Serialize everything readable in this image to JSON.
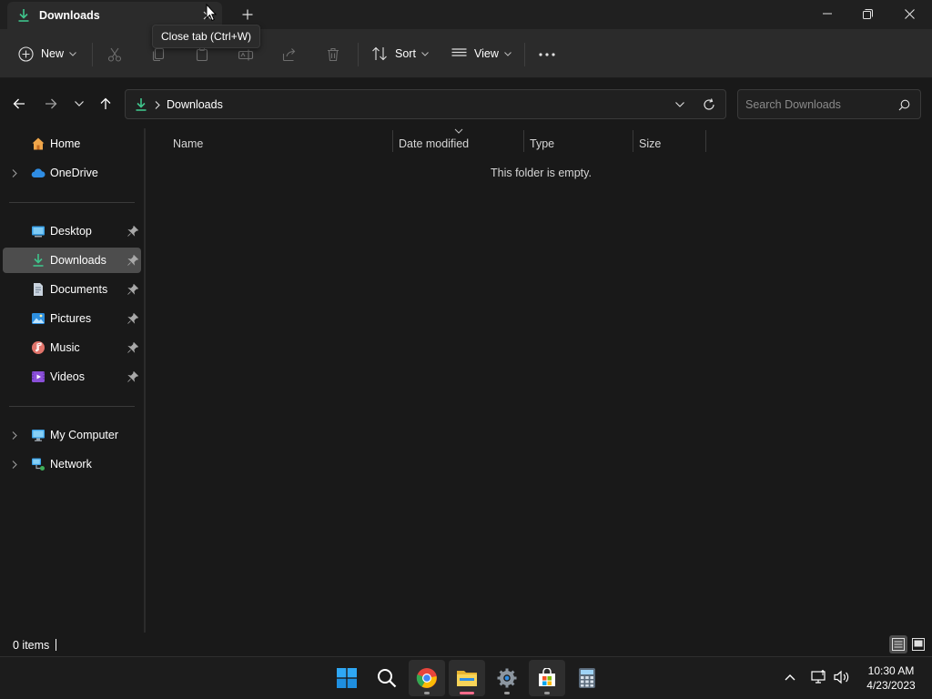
{
  "window": {
    "tab_title": "Downloads",
    "tooltip": "Close tab (Ctrl+W)"
  },
  "commandbar": {
    "new_label": "New",
    "sort_label": "Sort",
    "view_label": "View"
  },
  "address": {
    "path": "Downloads",
    "search_placeholder": "Search Downloads"
  },
  "sidebar": {
    "items": [
      {
        "label": "Home",
        "icon": "home-icon"
      },
      {
        "label": "OneDrive",
        "icon": "cloud-icon"
      },
      {
        "label": "Desktop",
        "icon": "desktop-icon"
      },
      {
        "label": "Downloads",
        "icon": "download-icon"
      },
      {
        "label": "Documents",
        "icon": "documents-icon"
      },
      {
        "label": "Pictures",
        "icon": "pictures-icon"
      },
      {
        "label": "Music",
        "icon": "music-icon"
      },
      {
        "label": "Videos",
        "icon": "videos-icon"
      },
      {
        "label": "My Computer",
        "icon": "computer-icon"
      },
      {
        "label": "Network",
        "icon": "network-icon"
      }
    ],
    "selected": "Downloads"
  },
  "content": {
    "columns": [
      "Name",
      "Date modified",
      "Type",
      "Size"
    ],
    "empty_message": "This folder is empty."
  },
  "status": {
    "item_count": "0 items"
  },
  "taskbar": {
    "apps": [
      "start-icon",
      "search-icon",
      "chrome-icon",
      "file-explorer-icon",
      "settings-icon",
      "store-icon",
      "calculator-icon"
    ],
    "time": "10:30 AM",
    "date": "4/23/2023"
  },
  "colors": {
    "accent_green": "#3fc38b",
    "background": "#191919",
    "toolbar": "#2b2b2b",
    "selected": "#4d4d4d"
  }
}
